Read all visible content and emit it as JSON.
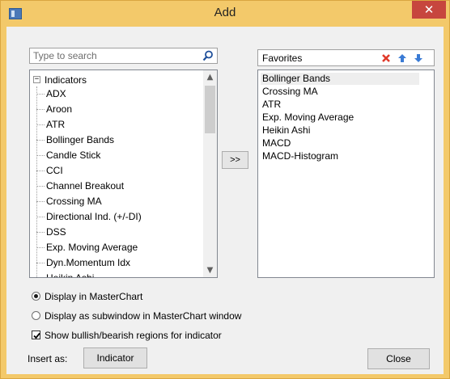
{
  "window": {
    "title": "Add",
    "close_glyph": "✕"
  },
  "search": {
    "placeholder": "Type to search",
    "value": ""
  },
  "tree": {
    "root_label": "Indicators",
    "expander": "−",
    "items": [
      "ADX",
      "Aroon",
      "ATR",
      "Bollinger Bands",
      "Candle Stick",
      "CCI",
      "Channel Breakout",
      "Crossing MA",
      "Directional Ind. (+/-DI)",
      "DSS",
      "Exp. Moving Average",
      "Dyn.Momentum Idx",
      "Heikin Ashi"
    ]
  },
  "move_button": {
    "label": ">>"
  },
  "favorites": {
    "title": "Favorites",
    "items": [
      "Bollinger Bands",
      "Crossing MA",
      "ATR",
      "Exp. Moving Average",
      "Heikin Ashi",
      "MACD",
      "MACD-Histogram"
    ],
    "selected_index": 0
  },
  "options": {
    "display_master": {
      "label": "Display in MasterChart",
      "selected": true
    },
    "display_sub": {
      "label": "Display as subwindow in MasterChart window",
      "selected": false
    },
    "show_regions": {
      "label": "Show bullish/bearish regions for indicator",
      "checked": true
    }
  },
  "footer": {
    "insert_label": "Insert as:",
    "indicator_button": "Indicator",
    "close_button": "Close"
  },
  "icons": {
    "app": "app-icon",
    "search": "search-icon",
    "remove": "red-x-icon",
    "up": "arrow-up-icon",
    "down": "arrow-down-icon"
  },
  "colors": {
    "title_bar": "#f3c96a",
    "close_button": "#c7463e",
    "remove_icon": "#e03a2a",
    "arrow_icon": "#3a7bd5"
  }
}
